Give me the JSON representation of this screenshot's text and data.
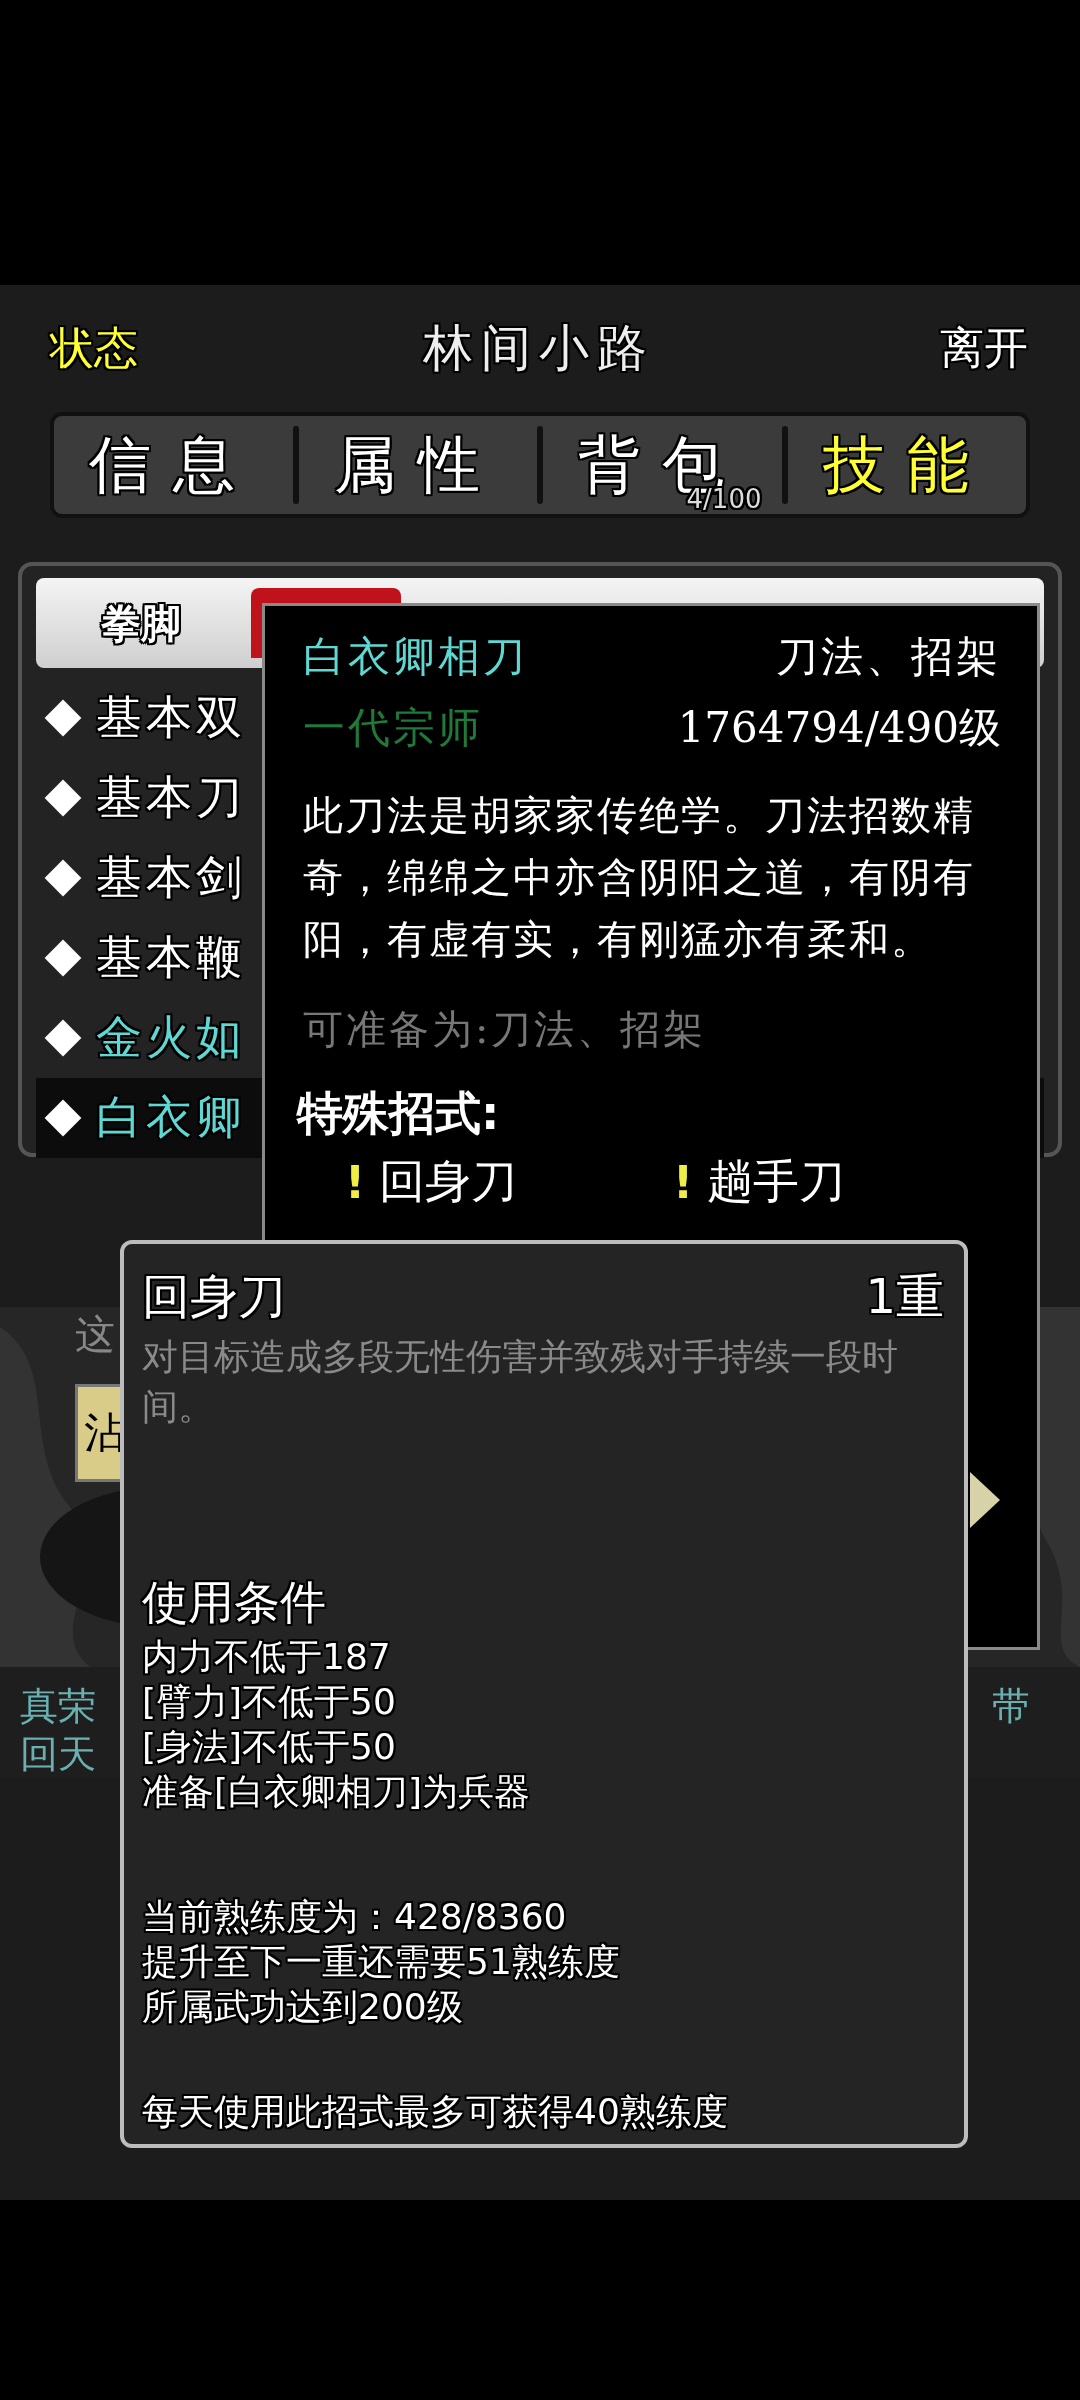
{
  "header": {
    "left": "状态",
    "title": "林间小路",
    "right": "离开"
  },
  "tabs": [
    {
      "label": "信息",
      "selected": false
    },
    {
      "label": "属性",
      "selected": false
    },
    {
      "label": "背包",
      "badge": "4/100",
      "selected": false
    },
    {
      "label": "技能",
      "selected": true
    }
  ],
  "categories": [
    {
      "label": "拳脚",
      "selected": false
    },
    {
      "selected": true
    }
  ],
  "skills": [
    {
      "name": "基本双",
      "color": "#ffffff",
      "selected": false
    },
    {
      "name": "基本刀",
      "color": "#ffffff",
      "selected": false
    },
    {
      "name": "基本剑",
      "color": "#ffffff",
      "selected": false
    },
    {
      "name": "基本鞭",
      "color": "#ffffff",
      "selected": false
    },
    {
      "name": "金火如",
      "color": "#5fd8d4",
      "selected": false
    },
    {
      "name": "白衣卿",
      "color": "#5fd8d4",
      "selected": true
    }
  ],
  "behind": {
    "text_1": "这",
    "button": "沾",
    "line_1": "真荣",
    "line_2": "回天",
    "right_text": "带"
  },
  "skill_popup": {
    "name": "白衣卿相刀",
    "types": "刀法、招架",
    "rank": "一代宗师",
    "progress": "1764794/490级",
    "description": "此刀法是胡家家传绝学。刀法招数精奇，绵绵之中亦含阴阳之道，有阴有阳，有虚有实，有刚猛亦有柔和。",
    "prepare": "可准备为:刀法、招架",
    "moves_title": "特殊招式:",
    "moves": [
      {
        "mark": "!",
        "name": "回身刀"
      },
      {
        "mark": "!",
        "name": "趟手刀"
      }
    ]
  },
  "move_popup": {
    "title": "回身刀",
    "level": "1重",
    "description": "对目标造成多段无性伤害并致残对手持续一段时间。",
    "conditions_title": "使用条件",
    "conditions": [
      "内力不低于187",
      "[臂力]不低于50",
      "[身法]不低于50",
      "准备[白衣卿相刀]为兵器"
    ],
    "progress": [
      "当前熟练度为：428/8360",
      "提升至下一重还需要51熟练度",
      "所属武功达到200级"
    ],
    "note": "每天使用此招式最多可获得40熟练度"
  }
}
